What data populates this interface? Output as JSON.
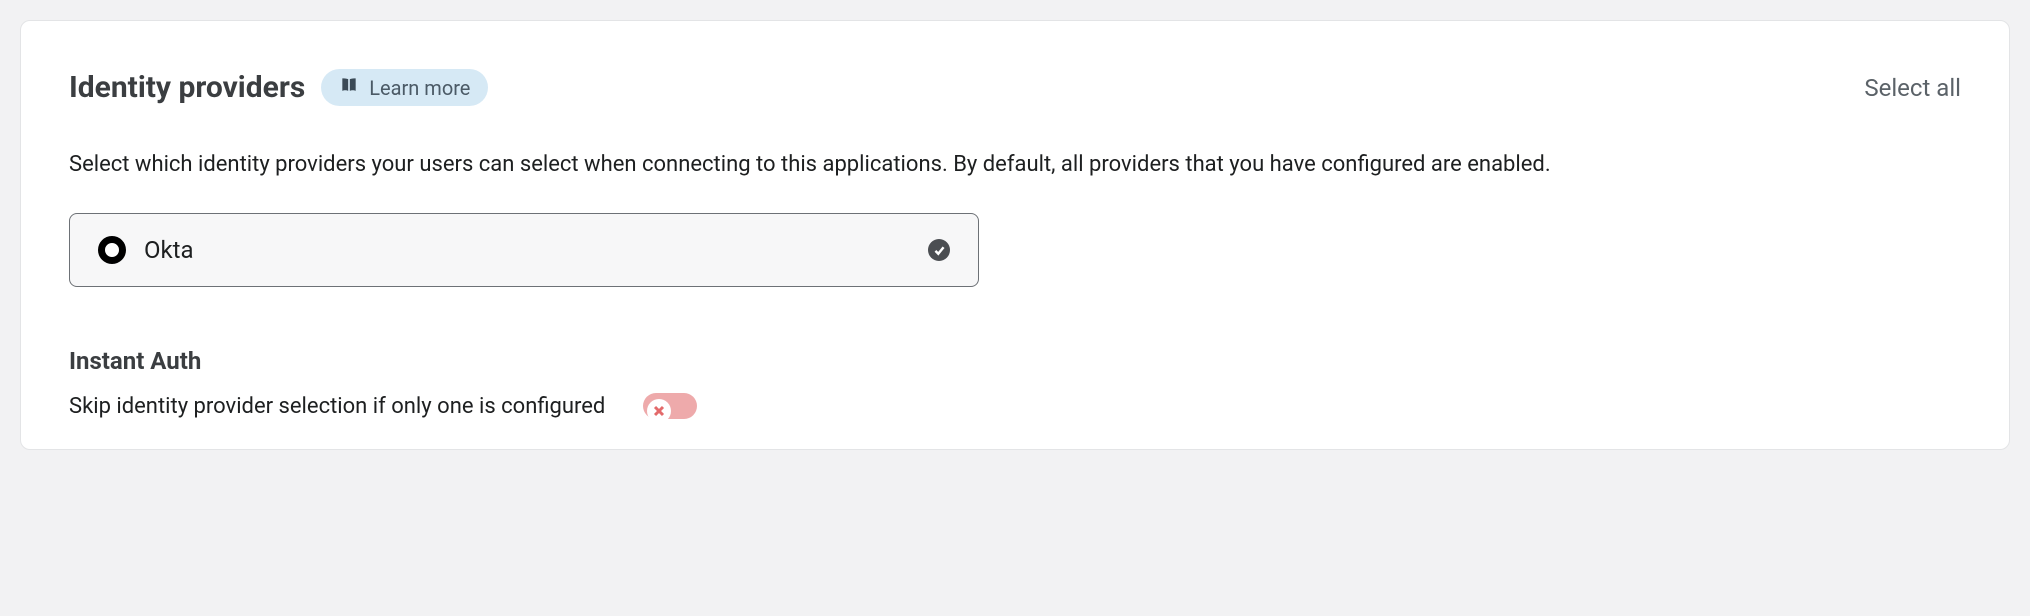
{
  "header": {
    "title": "Identity providers",
    "learn_more": "Learn more",
    "select_all": "Select all"
  },
  "description": "Select which identity providers your users can select when connecting to this applications. By default, all providers that you have configured are enabled.",
  "providers": [
    {
      "label": "Okta",
      "selected": true
    }
  ],
  "instant_auth": {
    "title": "Instant Auth",
    "description": "Skip identity provider selection if only one is configured",
    "enabled": false
  }
}
